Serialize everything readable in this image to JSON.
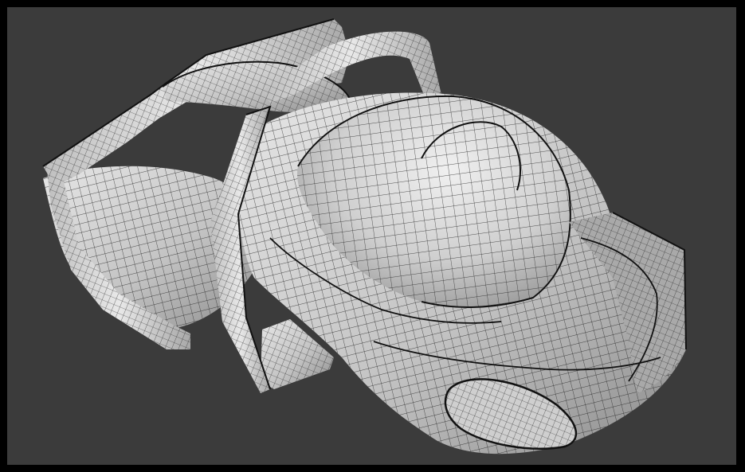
{
  "viewport": {
    "background": "#3b3b3b",
    "frame": "#000000",
    "surface_light": "#d9d9d9",
    "surface_shade": "#8a8a8a",
    "wire_color": "#1a1a1a"
  },
  "model": {
    "kind": "wireframe-subdivision-vehicle-body"
  }
}
